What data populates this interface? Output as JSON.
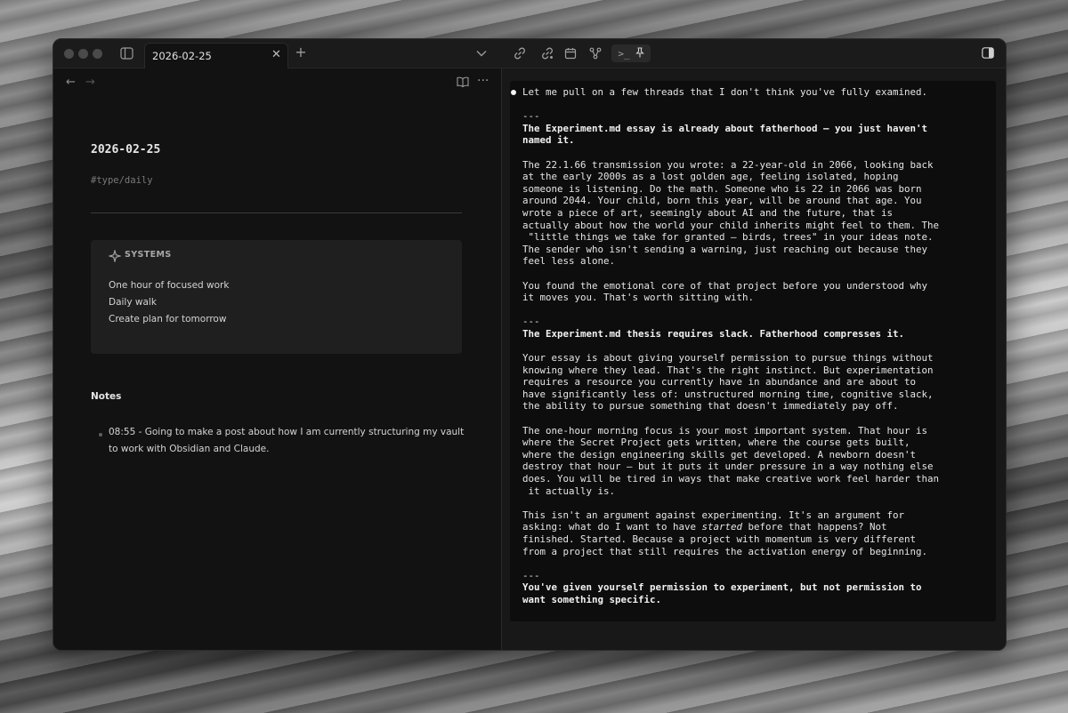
{
  "tab": {
    "title": "2026-02-25"
  },
  "note": {
    "title": "2026-02-25",
    "tag": "#type/daily",
    "callout": {
      "title": "SYSTEMS",
      "items": [
        "One hour of focused work",
        "Daily walk",
        "Create plan for tomorrow"
      ]
    },
    "notes_heading": "Notes",
    "bullet": "08:55 - Going to make a post about how I am currently structuring my vault to work with Obsidian and Claude."
  },
  "terminal": {
    "term_label": ">_",
    "intro": "Let me pull on a few threads that I don't think you've fully examined.",
    "sections": [
      {
        "sep": "---",
        "heading": "The Experiment.md essay is already about fatherhood — you just haven't\nnamed it.",
        "paragraphs": [
          "The 22.1.66 transmission you wrote: a 22-year-old in 2066, looking back\nat the early 2000s as a lost golden age, feeling isolated, hoping\nsomeone is listening. Do the math. Someone who is 22 in 2066 was born\naround 2044. Your child, born this year, will be around that age. You\nwrote a piece of art, seemingly about AI and the future, that is\nactually about how the world your child inherits might feel to them. The\n \"little things we take for granted — birds, trees\" in your ideas note.\nThe sender who isn't sending a warning, just reaching out because they\nfeel less alone.",
          "You found the emotional core of that project before you understood why\nit moves you. That's worth sitting with."
        ]
      },
      {
        "sep": "---",
        "heading": "The Experiment.md thesis requires slack. Fatherhood compresses it.",
        "paragraphs": [
          "Your essay is about giving yourself permission to pursue things without\nknowing where they lead. That's the right instinct. But experimentation\nrequires a resource you currently have in abundance and are about to\nhave significantly less of: unstructured morning time, cognitive slack,\nthe ability to pursue something that doesn't immediately pay off.",
          "The one-hour morning focus is your most important system. That hour is\nwhere the Secret Project gets written, where the course gets built,\nwhere the design engineering skills get developed. A newborn doesn't\ndestroy that hour — but it puts it under pressure in a way nothing else\ndoes. You will be tired in ways that make creative work feel harder than\n it actually is."
        ],
        "final_paragraph": {
          "before": "This isn't an argument against experimenting. It's an argument for\nasking: what do I want to have ",
          "emphasis": "started",
          "after": " before that happens? Not\nfinished. Started. Because a project with momentum is very different\nfrom a project that still requires the activation energy of beginning."
        }
      },
      {
        "sep": "---",
        "heading": "You've given yourself permission to experiment, but not permission to\nwant something specific."
      }
    ]
  }
}
